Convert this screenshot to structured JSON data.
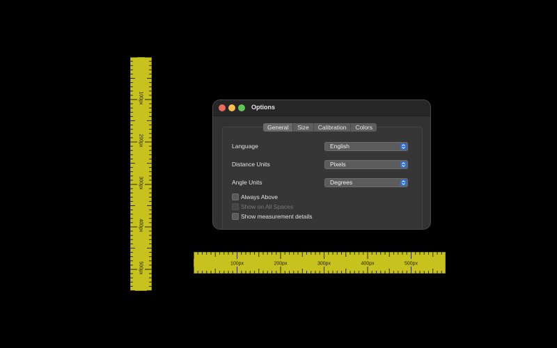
{
  "window": {
    "title": "Options",
    "tabs": [
      {
        "label": "General",
        "selected": true
      },
      {
        "label": "Size",
        "selected": false
      },
      {
        "label": "Calibration",
        "selected": false
      },
      {
        "label": "Colors",
        "selected": false
      }
    ],
    "settings": {
      "language": {
        "label": "Language",
        "value": "English"
      },
      "distance_units": {
        "label": "Distance Units",
        "value": "Pixels"
      },
      "angle_units": {
        "label": "Angle Units",
        "value": "Degrees"
      }
    },
    "checkboxes": {
      "always_above": {
        "label": "Always Above",
        "checked": false,
        "enabled": true
      },
      "show_all_spaces": {
        "label": "Show on All Spaces",
        "checked": false,
        "enabled": false
      },
      "show_details": {
        "label": "Show measurement details",
        "checked": false,
        "enabled": true
      }
    }
  },
  "rulers": {
    "vertical_labels": [
      "100px",
      "200px",
      "300px",
      "400px",
      "500px"
    ],
    "horizontal_labels": [
      "100px",
      "200px",
      "300px",
      "400px",
      "500px"
    ]
  },
  "colors": {
    "ruler": "#c8c21e",
    "accent": "#2f6fe0",
    "close": "#ed6a5e",
    "minimize": "#f5bf4f",
    "maximize": "#61c554"
  },
  "icons": {
    "popup_arrow": "chevron-updown-icon"
  }
}
